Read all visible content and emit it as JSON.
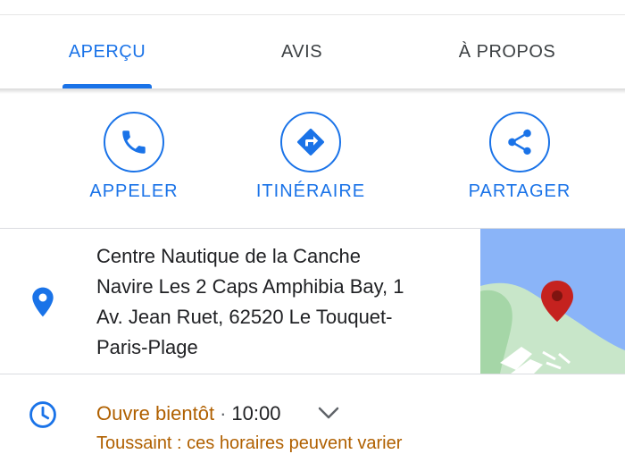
{
  "tabs": [
    {
      "label": "APERÇU",
      "active": true
    },
    {
      "label": "AVIS",
      "active": false
    },
    {
      "label": "À PROPOS",
      "active": false
    }
  ],
  "actions": [
    {
      "label": "APPELER",
      "icon": "phone-icon"
    },
    {
      "label": "ITINÉRAIRE",
      "icon": "directions-icon"
    },
    {
      "label": "PARTAGER",
      "icon": "share-icon"
    }
  ],
  "address": {
    "lines": [
      "Centre Nautique de la Canche",
      "Navire Les 2 Caps Amphibia Bay, 1",
      "Av. Jean Ruet, 62520 Le Touquet-",
      "Paris-Plage"
    ],
    "icon": "location-pin-icon"
  },
  "hours": {
    "status": "Ouvre bientôt",
    "separator": "·",
    "time": "10:00",
    "note": "Toussaint : ces horaires peuvent varier"
  },
  "colors": {
    "accent": "#1a73e8",
    "warning": "#b06000",
    "pin": "#c5221f",
    "water": "#8ab4f8",
    "land": "#b5d9b7"
  }
}
